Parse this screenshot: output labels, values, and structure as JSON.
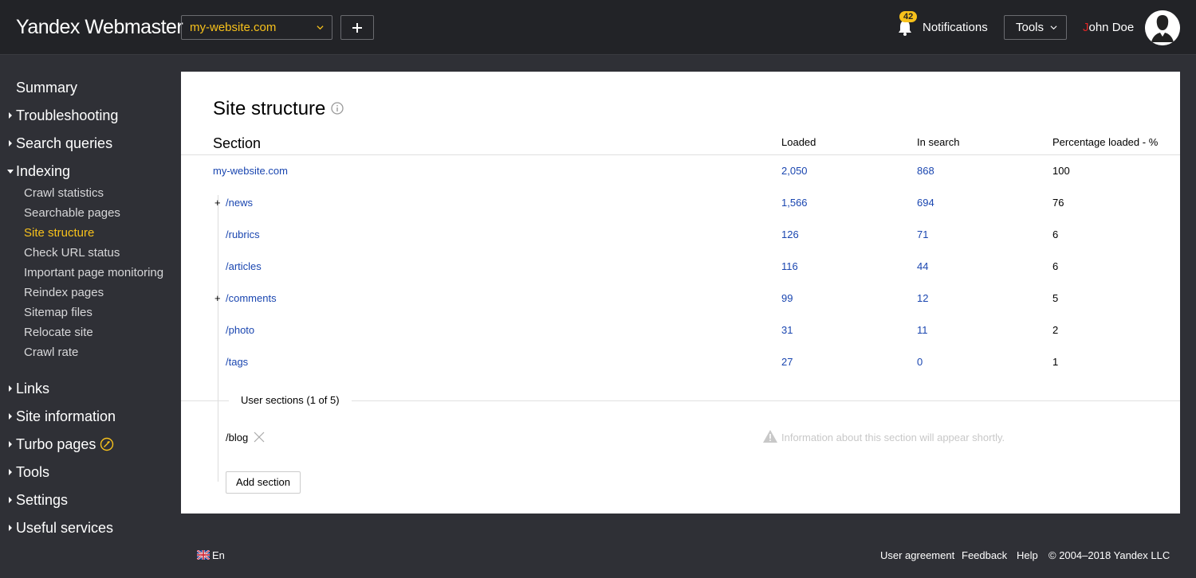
{
  "header": {
    "logo_bold": "Yandex",
    "logo_light": "Webmaster",
    "site": "my-website.com",
    "notifications_count": "42",
    "notifications_label": "Notifications",
    "tools_label": "Tools",
    "user_first_letter": "J",
    "user_rest": "ohn Doe"
  },
  "sidebar": {
    "top": [
      {
        "label": "Summary"
      },
      {
        "label": "Troubleshooting"
      },
      {
        "label": "Search queries"
      },
      {
        "label": "Indexing"
      },
      {
        "label": "Links"
      },
      {
        "label": "Site information"
      },
      {
        "label": "Turbo pages"
      },
      {
        "label": "Tools"
      },
      {
        "label": "Settings"
      },
      {
        "label": "Useful services"
      }
    ],
    "indexing_items": [
      {
        "label": "Crawl statistics"
      },
      {
        "label": "Searchable pages"
      },
      {
        "label": "Site structure"
      },
      {
        "label": "Check URL status"
      },
      {
        "label": "Important page monitoring"
      },
      {
        "label": "Reindex pages"
      },
      {
        "label": "Sitemap files"
      },
      {
        "label": "Relocate site"
      },
      {
        "label": "Crawl rate"
      }
    ]
  },
  "main": {
    "title": "Site structure",
    "columns": {
      "section": "Section",
      "loaded": "Loaded",
      "in_search": "In search",
      "percent": "Percentage loaded - %"
    },
    "rows": [
      {
        "section": "my-website.com",
        "loaded": "2,050",
        "in_search": "868",
        "percent": "100"
      },
      {
        "section": "/news",
        "loaded": "1,566",
        "in_search": "694",
        "percent": "76"
      },
      {
        "section": "/rubrics",
        "loaded": "126",
        "in_search": "71",
        "percent": "6"
      },
      {
        "section": "/articles",
        "loaded": "116",
        "in_search": "44",
        "percent": "6"
      },
      {
        "section": "/comments",
        "loaded": "99",
        "in_search": "12",
        "percent": "5"
      },
      {
        "section": "/photo",
        "loaded": "31",
        "in_search": "11",
        "percent": "2"
      },
      {
        "section": "/tags",
        "loaded": "27",
        "in_search": "0",
        "percent": "1"
      }
    ],
    "expand_symbol": "+",
    "user_sections_label": "User sections (1 of 5)",
    "user_section": "/blog",
    "user_section_notice": "Information about this section will appear shortly.",
    "add_section_label": "Add section"
  },
  "footer": {
    "language": "En",
    "user_agreement": "User agreement",
    "feedback": "Feedback",
    "help": "Help",
    "copyright": "© 2004–2018  Yandex LLC"
  }
}
